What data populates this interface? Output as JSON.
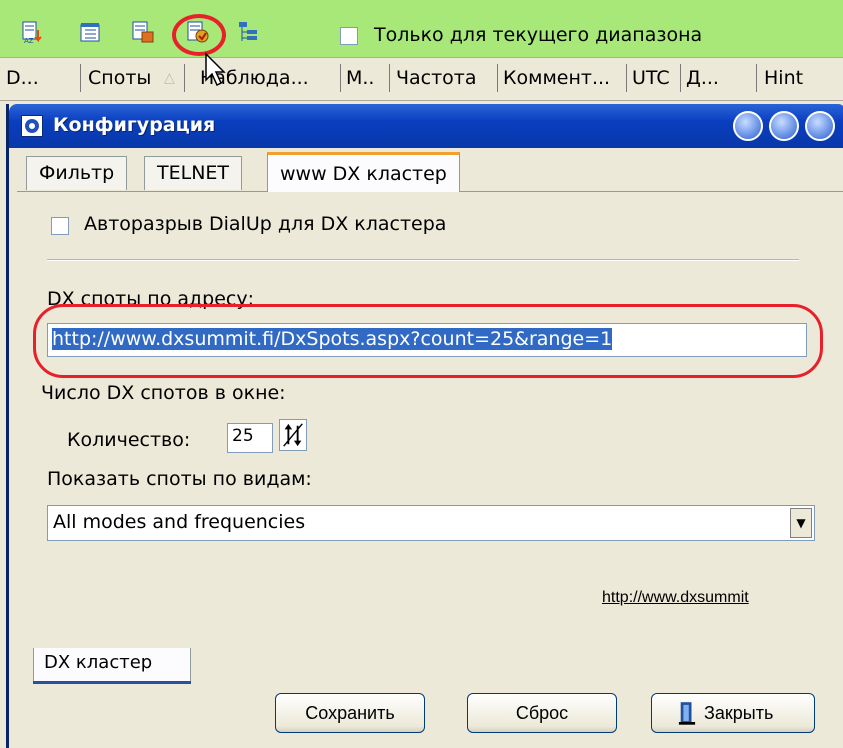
{
  "toolbar": {
    "icons": [
      "sort-icon",
      "notepad-icon",
      "export-icon",
      "cluster-config-icon",
      "tree-icon"
    ],
    "only_current_range_label": "Только для текущего диапазона"
  },
  "columns": [
    "D...",
    "Споты",
    "Наблюда...",
    "M..",
    "Частота",
    "Коммент...",
    "UTC",
    "Д...",
    "Hint"
  ],
  "window": {
    "title": "Конфигурация",
    "tabs": [
      "Фильтр",
      "TELNET",
      "www DX кластер"
    ],
    "active_tab": "www DX кластер",
    "autodisconnect_label": "Авторазрыв DialUp для DX кластера",
    "spots_address_label": "DX споты по адресу:",
    "spots_address_value": "http://www.dxsummit.fi/DxSpots.aspx?count=25&range=1",
    "spots_count_label": "Число DX спотов в окне:",
    "quantity_label": "Количество:",
    "quantity_value": "25",
    "show_by_mode_label": "Показать споты по видам:",
    "mode_selected": "All modes and frequencies",
    "link_text": "http://www.dxsummit",
    "bottom_tab": "DX кластер",
    "buttons": {
      "save": "Сохранить",
      "reset": "Сброс",
      "close": "Закрыть"
    }
  },
  "colors": {
    "toolbar": "#a8e878",
    "highlight": "#e8202a",
    "titlebar": "#0a3ec0",
    "selection": "#316ac5"
  }
}
